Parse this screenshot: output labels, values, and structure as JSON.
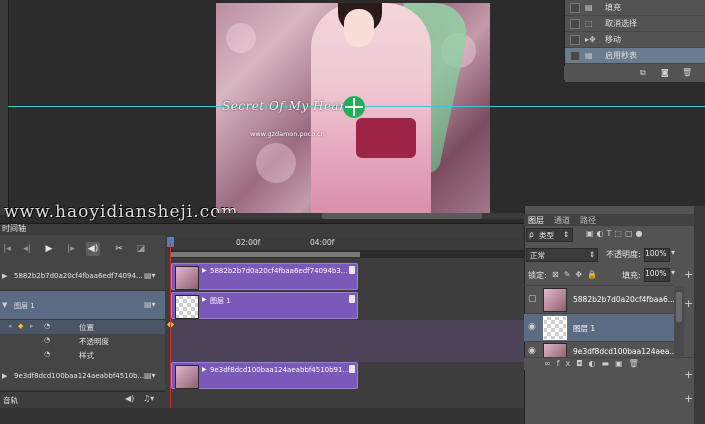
{
  "canvas": {
    "watermark_script": "Secret Of My Heart",
    "watermark_url": "www.gzdamon.poco.cn",
    "site_watermark": "www.haoyidiansheji.com",
    "guide_color": "#3fc8c8"
  },
  "history": {
    "items": [
      {
        "label": "填充",
        "icon": "fill-icon"
      },
      {
        "label": "取消选择",
        "icon": "deselect-icon"
      },
      {
        "label": "移动",
        "icon": "move-icon"
      },
      {
        "label": "启用秒表",
        "icon": "stopwatch-icon",
        "selected": true
      }
    ]
  },
  "timeline": {
    "tab_label": "时间轴",
    "ruler": {
      "start": "",
      "mark1": "02:00f",
      "mark2": "04:00f"
    },
    "tracks": [
      {
        "name": "5882b2b7d0a20cf4fbaa6edf74094...",
        "clip_name": "5882b2b7d0a20cf4fbaa6edf74094b3..."
      },
      {
        "name": "图层 1",
        "clip_name": "图层 1"
      },
      {
        "name": "9e3df8dcd100baa124aeabbf4510b...",
        "clip_name": "9e3df8dcd100baa124aeabbf4510b91..."
      }
    ],
    "properties": [
      "位置",
      "不透明度",
      "样式"
    ],
    "audio_label": "音轨",
    "colors": {
      "clip": "#7b59b8",
      "playhead": "#d62f2f",
      "selection": "#5b6b83"
    }
  },
  "layers": {
    "tabs": [
      "图层",
      "通道",
      "路径"
    ],
    "filter_kind": "类型",
    "blend_mode": "正常",
    "opacity_label": "不透明度:",
    "opacity_value": "100%",
    "lock_label": "锁定:",
    "fill_label": "填充:",
    "fill_value": "100%",
    "items": [
      {
        "name": "5882b2b7d0a20cf4fbaa6...",
        "visible": false
      },
      {
        "name": "图层 1",
        "visible": true,
        "selected": true
      },
      {
        "name": "9e3df8dcd100baa124aea...",
        "visible": true
      }
    ]
  }
}
